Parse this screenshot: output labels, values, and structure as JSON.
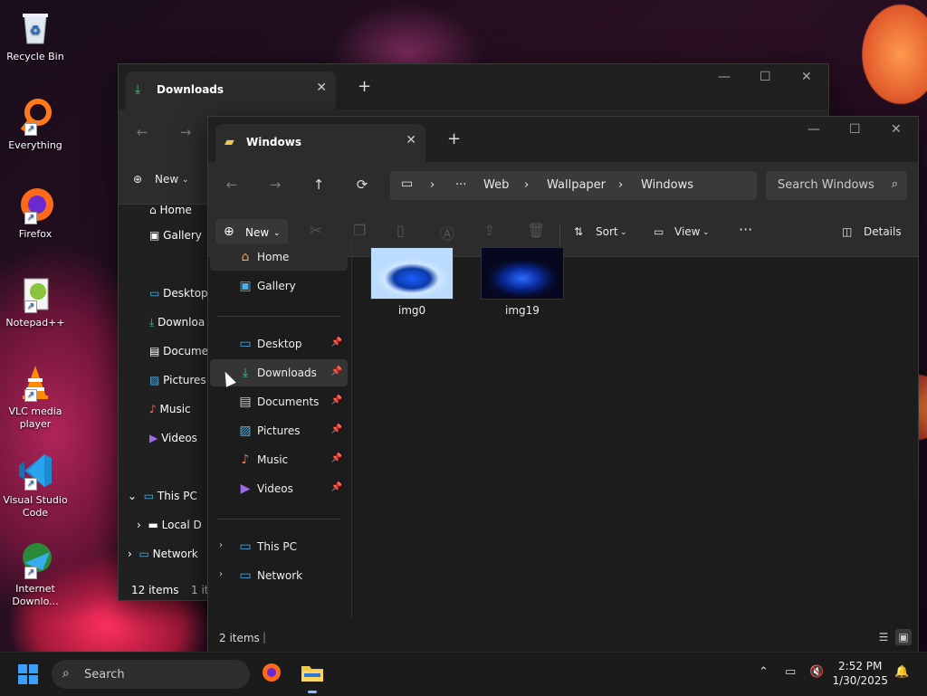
{
  "desktop": {
    "icons": [
      {
        "label": "Recycle Bin",
        "icon": "recycle-bin-icon"
      },
      {
        "label": "Everything",
        "icon": "search-magnifier-icon"
      },
      {
        "label": "Firefox",
        "icon": "firefox-icon"
      },
      {
        "label": "Notepad++",
        "icon": "notepadpp-icon"
      },
      {
        "label": "VLC media player",
        "icon": "vlc-cone-icon"
      },
      {
        "label": "Visual Studio Code",
        "icon": "vscode-icon"
      },
      {
        "label": "Internet Downlo...",
        "icon": "idm-globe-icon"
      }
    ]
  },
  "back_window": {
    "tab_title": "Downloads",
    "new_label": "New",
    "sidebar": [
      "Home",
      "Gallery",
      "Desktop",
      "Downloa",
      "Docume",
      "Pictures",
      "Music",
      "Videos",
      "This PC",
      "Local D",
      "Network"
    ],
    "status_items": "12 items",
    "status_selected": "1 ite"
  },
  "window": {
    "tab_title": "Windows",
    "breadcrumb": [
      "Web",
      "Wallpaper",
      "Windows"
    ],
    "search_placeholder": "Search Windows",
    "toolbar": {
      "new_label": "New",
      "sort_label": "Sort",
      "view_label": "View",
      "details_label": "Details"
    },
    "sidebar": {
      "home": "Home",
      "gallery": "Gallery",
      "pinned": [
        "Desktop",
        "Downloads",
        "Documents",
        "Pictures",
        "Music",
        "Videos"
      ],
      "this_pc": "This PC",
      "network": "Network"
    },
    "files": [
      {
        "name": "img0"
      },
      {
        "name": "img19"
      }
    ],
    "status_items": "2 items"
  },
  "taskbar": {
    "search_placeholder": "Search",
    "time": "2:52 PM",
    "date": "1/30/2025"
  },
  "colors": {
    "accent": "#3ba0ff",
    "download_green": "#3fc47a",
    "folder_yellow": "#f2c84b"
  }
}
